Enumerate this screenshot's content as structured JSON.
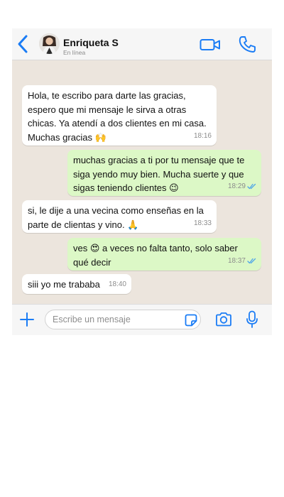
{
  "header": {
    "contact_name": "Enriqueta S",
    "status": "En línea"
  },
  "messages": [
    {
      "direction": "incoming",
      "text": "Hola, te escribo para darte las gracias, espero que mi mensaje le sirva a otras chicas. Ya atendí a dos clientes en mi casa. Muchas gracias",
      "emoji": "🙌",
      "time": "18:16"
    },
    {
      "direction": "outgoing",
      "text": "muchas gracias a ti por tu mensaje que te siga yendo muy bien. Mucha suerte y que sigas teniendo clientes",
      "emoji": "😉",
      "time": "18:29",
      "read": true
    },
    {
      "direction": "incoming",
      "text": "si, le dije a una vecina como enseñas en la parte de clientas y vino.",
      "emoji": "🙏",
      "time": "18:33"
    },
    {
      "direction": "outgoing",
      "text_before": "ves",
      "emoji": "😍",
      "text_after": "a veces no falta tanto, solo saber qué decir",
      "time": "18:37",
      "read": true
    },
    {
      "direction": "incoming",
      "text": "siii yo me trababa",
      "time": "18:40"
    }
  ],
  "input": {
    "placeholder": "Escribe un mensaje"
  },
  "colors": {
    "accent": "#1a7cf5",
    "outgoing_bubble": "#dcf8c6",
    "incoming_bubble": "#ffffff",
    "chat_background": "#ece5dd",
    "read_ticks": "#4fa6e8"
  }
}
